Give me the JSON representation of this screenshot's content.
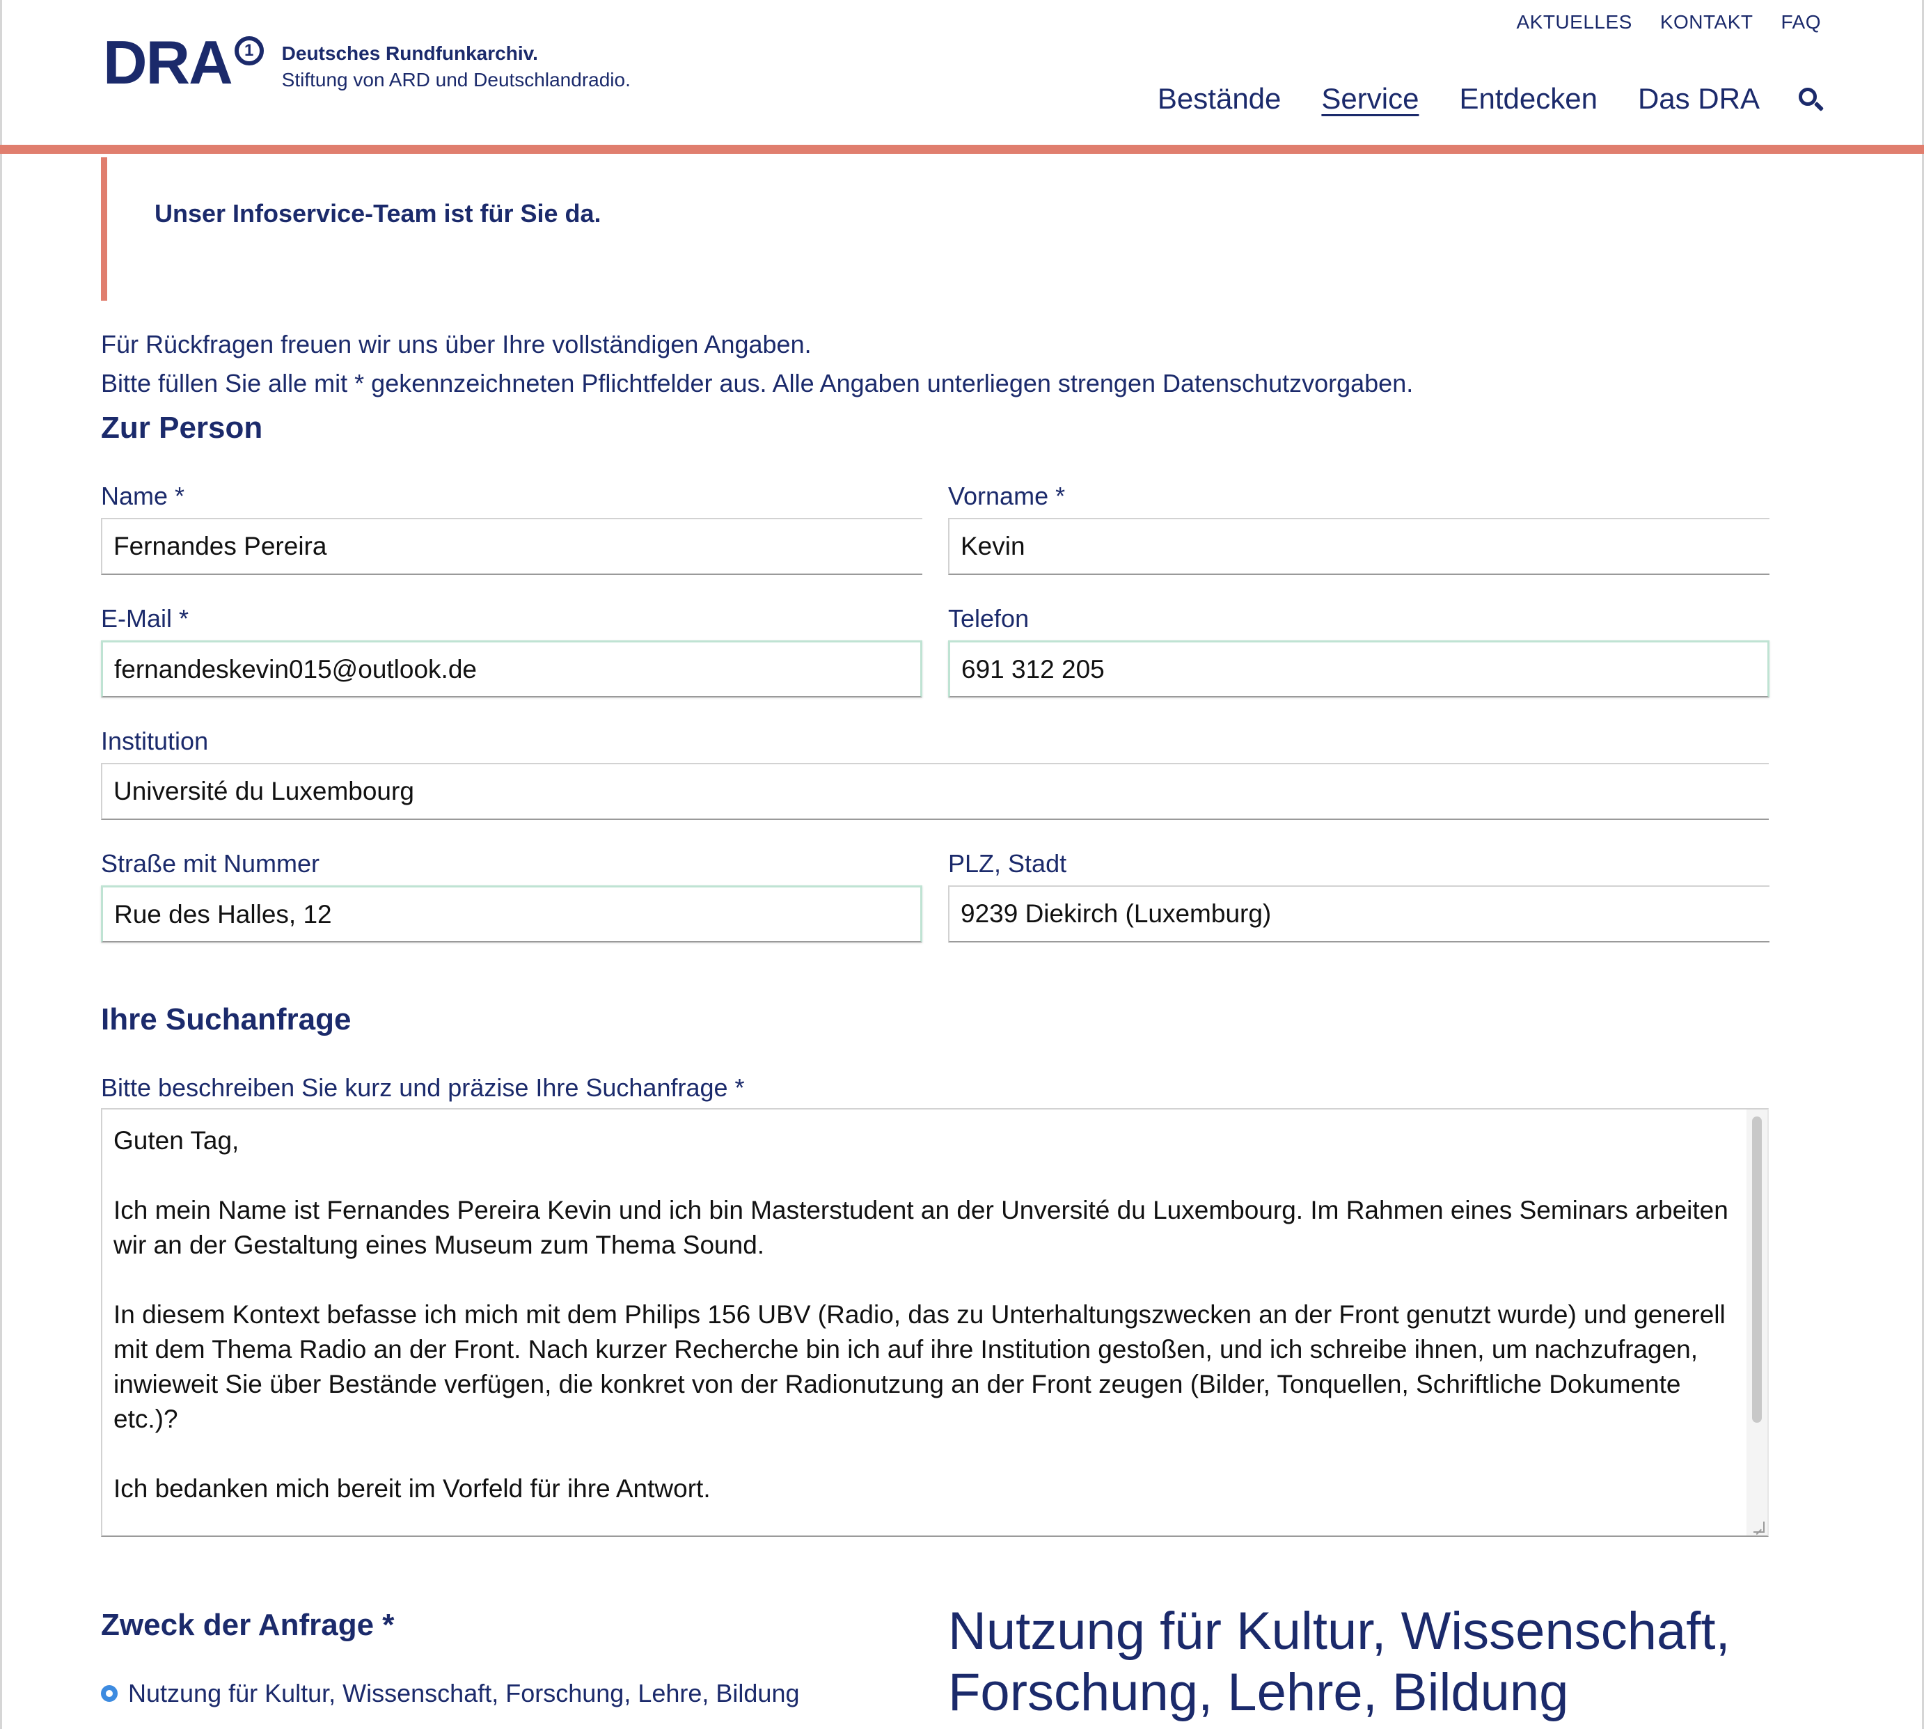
{
  "header": {
    "logo": {
      "mark": "DRA",
      "mark_superscript": "1",
      "name": "Deutsches Rundfunkarchiv.",
      "subtitle": "Stiftung von ARD und Deutschlandradio."
    },
    "top_nav": [
      "AKTUELLES",
      "KONTAKT",
      "FAQ"
    ],
    "main_nav": [
      "Bestände",
      "Service",
      "Entdecken",
      "Das DRA"
    ],
    "active_nav": "Service",
    "search_icon": "search-icon"
  },
  "colors": {
    "navy": "#1b2a6b",
    "accent": "#e07e6e",
    "radio": "#3d8be0"
  },
  "info_box": {
    "title": "Unser Infoservice-Team ist für Sie da."
  },
  "intro": {
    "line1": "Für Rückfragen freuen wir uns über Ihre vollständigen Angaben.",
    "line2": "Bitte füllen Sie alle mit * gekennzeichneten Pflichtfelder aus. Alle Angaben unterliegen strengen Datenschutzvorgaben."
  },
  "person": {
    "heading": "Zur Person",
    "name": {
      "label": "Name *",
      "value": "Fernandes Pereira"
    },
    "vorname": {
      "label": "Vorname *",
      "value": "Kevin"
    },
    "email": {
      "label": "E-Mail *",
      "value": "fernandeskevin015@outlook.de"
    },
    "telefon": {
      "label": "Telefon",
      "value": "691 312 205"
    },
    "institution": {
      "label": "Institution",
      "value": "Université du Luxembourg"
    },
    "strasse": {
      "label": "Straße mit Nummer",
      "value": "Rue des Halles, 12"
    },
    "plz": {
      "label": "PLZ, Stadt",
      "value": "9239 Diekirch (Luxemburg)"
    }
  },
  "request": {
    "heading": "Ihre Suchanfrage",
    "label": "Bitte beschreiben Sie kurz und präzise Ihre Suchanfrage *",
    "text": "Guten Tag,\n\nIch mein Name ist Fernandes Pereira Kevin und ich bin Masterstudent an der Unversité du Luxembourg. Im Rahmen eines Seminars arbeiten wir an der Gestaltung eines Museum zum Thema Sound.\n\nIn diesem Kontext befasse ich mich mit dem Philips 156 UBV (Radio, das zu Unterhaltungszwecken an der Front genutzt wurde) und generell mit dem Thema Radio an der Front. Nach kurzer Recherche bin ich auf ihre Institution gestoßen, und ich schreibe ihnen, um nachzufragen, inwieweit Sie über Bestände verfügen, die konkret von der Radionutzung an der Front zeugen (Bilder, Tonquellen, Schriftliche Dokumente etc.)?\n\nIch bedanken mich bereit im Vorfeld für ihre Antwort."
  },
  "purpose": {
    "heading": "Zweck der Anfrage *",
    "selected_option": "Nutzung für Kultur, Wissenschaft, Forschung, Lehre, Bildung",
    "detail_heading": "Nutzung für Kultur, Wissenschaft, Forschung, Lehre, Bildung"
  }
}
